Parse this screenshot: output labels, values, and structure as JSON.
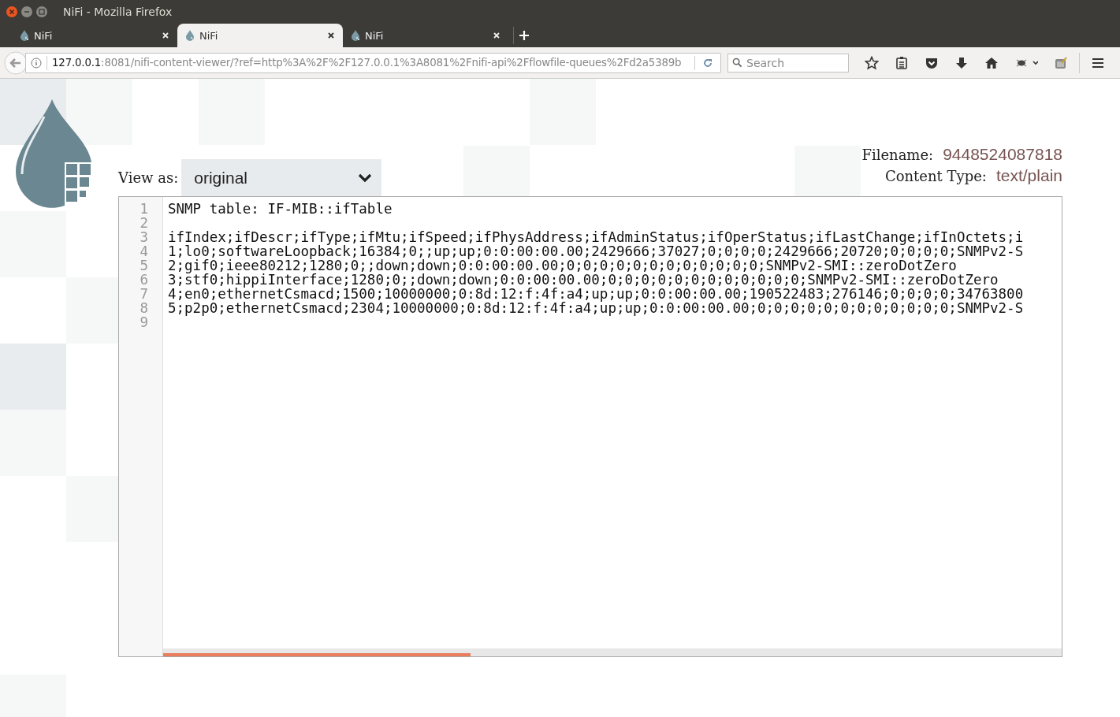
{
  "window": {
    "title": "NiFi - Mozilla Firefox"
  },
  "tabs": [
    {
      "label": "NiFi",
      "selected": false
    },
    {
      "label": "NiFi",
      "selected": true
    },
    {
      "label": "NiFi",
      "selected": false
    }
  ],
  "address_bar": {
    "host": "127.0.0.1",
    "path": ":8081/nifi-content-viewer/?ref=http%3A%2F%2F127.0.0.1%3A8081%2Fnifi-api%2Fflowfile-queues%2Fd2a5389b"
  },
  "search": {
    "placeholder": "Search"
  },
  "view_as": {
    "label": "View as:",
    "value": "original"
  },
  "file_info": [
    {
      "label": "Filename:",
      "value": "9448524087818"
    },
    {
      "label": "Content Type:",
      "value": "text/plain"
    }
  ],
  "editor": {
    "lines": [
      {
        "number": "1",
        "text": "SNMP table: IF-MIB::ifTable"
      },
      {
        "number": "2"
      },
      {
        "number": "3",
        "text": "ifIndex;ifDescr;ifType;ifMtu;ifSpeed;ifPhysAddress;ifAdminStatus;ifOperStatus;ifLastChange;ifInOctets;i"
      },
      {
        "number": "4",
        "text": "1;lo0;softwareLoopback;16384;0;;up;up;0:0:00:00.00;2429666;37027;0;0;0;0;2429666;20720;0;0;0;0;SNMPv2-S"
      },
      {
        "number": "5",
        "text": "2;gif0;ieee80212;1280;0;;down;down;0:0:00:00.00;0;0;0;0;0;0;0;0;0;0;0;0;SNMPv2-SMI::zeroDotZero"
      },
      {
        "number": "6",
        "text": "3;stf0;hippiInterface;1280;0;;down;down;0:0:00:00.00;0;0;0;0;0;0;0;0;0;0;0;0;SNMPv2-SMI::zeroDotZero"
      },
      {
        "number": "7",
        "text": "4;en0;ethernetCsmacd;1500;10000000;0:8d:12:f:4f:a4;up;up;0:0:00:00.00;190522483;276146;0;0;0;0;34763800"
      },
      {
        "number": "8",
        "text": "5;p2p0;ethernetCsmacd;2304;10000000;0:8d:12:f:4f:a4;up;up;0:0:00:00.00;0;0;0;0;0;0;0;0;0;0;0;0;SNMPv2-S"
      },
      {
        "number": "9"
      }
    ]
  }
}
